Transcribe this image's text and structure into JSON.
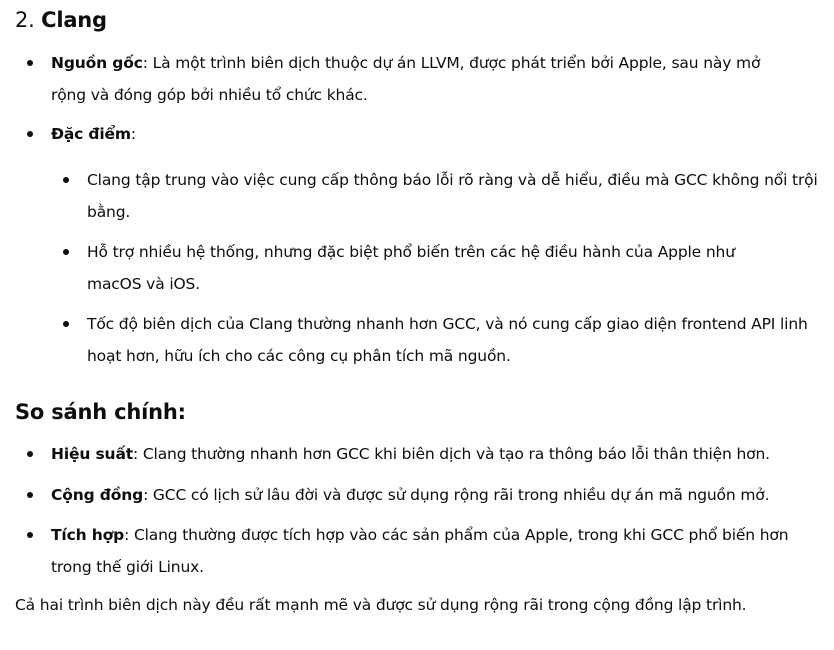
{
  "clang_section": {
    "heading_number": "2.",
    "heading_title": "Clang",
    "origin": {
      "term": "Nguồn gốc",
      "text": ": Là một trình biên dịch thuộc dự án LLVM, được phát triển bởi Apple, sau này mở rộng và đóng góp bởi nhiều tổ chức khác."
    },
    "features": {
      "term": "Đặc điểm",
      "text": ":",
      "items": [
        "Clang tập trung vào việc cung cấp thông báo lỗi rõ ràng và dễ hiểu, điều mà GCC không nổi trội bằng.",
        "Hỗ trợ nhiều hệ thống, nhưng đặc biệt phổ biến trên các hệ điều hành của Apple như macOS và iOS.",
        "Tốc độ biên dịch của Clang thường nhanh hơn GCC, và nó cung cấp giao diện frontend API linh hoạt hơn, hữu ích cho các công cụ phân tích mã nguồn."
      ]
    }
  },
  "comparison_section": {
    "heading": "So sánh chính:",
    "items": [
      {
        "term": "Hiệu suất",
        "text": ": Clang thường nhanh hơn GCC khi biên dịch và tạo ra thông báo lỗi thân thiện hơn."
      },
      {
        "term": "Cộng đồng",
        "text": ": GCC có lịch sử lâu đời và được sử dụng rộng rãi trong nhiều dự án mã nguồn mở."
      },
      {
        "term": "Tích hợp",
        "text": ": Clang thường được tích hợp vào các sản phẩm của Apple, trong khi GCC phổ biến hơn trong thế giới Linux."
      }
    ]
  },
  "closing": "Cả hai trình biên dịch này đều rất mạnh mẽ và được sử dụng rộng rãi trong cộng đồng lập trình."
}
